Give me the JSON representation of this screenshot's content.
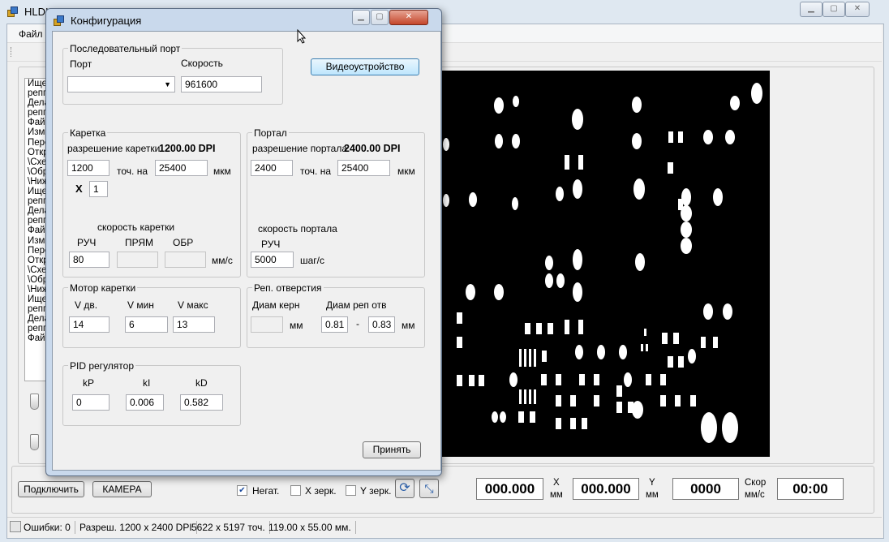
{
  "main": {
    "title": "HLDI",
    "menu_file": "Файл",
    "log_lines": [
      "Ищет",
      "репп",
      "Дела",
      "репп",
      "Фай",
      "Изм",
      "Пере",
      "Откр",
      "\\Схе",
      "\\Обр",
      "\\Ниж",
      "Ищет",
      "репп",
      "Дела",
      "репп",
      "Фай",
      "Изм",
      "Пере",
      "Откр",
      "\\Схе",
      "\\Обр",
      "\\Ниж",
      "Ищет",
      "репп",
      "Дела",
      "репп",
      "Фай"
    ],
    "buttons": {
      "connect": "Подключить",
      "camera": "КАМЕРА"
    },
    "checkboxes": [
      {
        "label": "Негат.",
        "checked": true
      },
      {
        "label": "X зерк.",
        "checked": false
      },
      {
        "label": "Y зерк.",
        "checked": false
      }
    ],
    "readouts": {
      "x_value": "000.000",
      "x_label": "X",
      "x_unit": "мм",
      "y_value": "000.000",
      "y_label": "Y",
      "y_unit": "мм",
      "speed_value": "0000",
      "speed_label": "Скор",
      "speed_unit": "мм/с",
      "time_value": "00:00"
    },
    "status": {
      "errors": "Ошибки: 0",
      "resolution": "Разреш. 1200 x 2400 DPI",
      "points": "5622 x 5197 точ.",
      "size": "119.00 x 55.00 мм."
    }
  },
  "dialog": {
    "title": "Конфигурация",
    "serial": {
      "group": "Последовательный порт",
      "port_label": "Порт",
      "port_value": "",
      "speed_label": "Скорость",
      "speed_value": "961600"
    },
    "video_button": "Видеоустройство",
    "carriage": {
      "group": "Каретка",
      "res_label": "разрешение каретки",
      "res_value": "1200.00 DPI",
      "dots": "1200",
      "dots_unit": "точ. на",
      "length": "25400",
      "length_unit": "мкм",
      "mult_label": "X",
      "mult": "1",
      "speed_title": "скорость каретки",
      "manual_label": "РУЧ",
      "forward_label": "ПРЯМ",
      "reverse_label": "ОБР",
      "manual": "80",
      "forward": "",
      "reverse": "",
      "speed_unit": "мм/с"
    },
    "portal": {
      "group": "Портал",
      "res_label": "разрешение портала",
      "res_value": "2400.00 DPI",
      "dots": "2400",
      "dots_unit": "точ. на",
      "length": "25400",
      "length_unit": "мкм",
      "speed_title": "скорость портала",
      "manual_label": "РУЧ",
      "manual": "5000",
      "speed_unit": "шаг/с"
    },
    "motor": {
      "group": "Мотор каретки",
      "vdv_label": "V дв.",
      "vmin_label": "V мин",
      "vmax_label": "V макс",
      "vdv": "14",
      "vmin": "6",
      "vmax": "13"
    },
    "rep": {
      "group": "Реп. отверстия",
      "kern_label": "Диам керн",
      "kern": "",
      "kern_unit": "мм",
      "hole_label": "Диам реп отв",
      "hole_min": "0.81",
      "dash": "-",
      "hole_max": "0.83",
      "hole_unit": "мм"
    },
    "pid": {
      "group": "PID регулятор",
      "kp_label": "kP",
      "ki_label": "kI",
      "kd_label": "kD",
      "kp": "0",
      "ki": "0.006",
      "kd": "0.582"
    },
    "accept": "Принять"
  }
}
